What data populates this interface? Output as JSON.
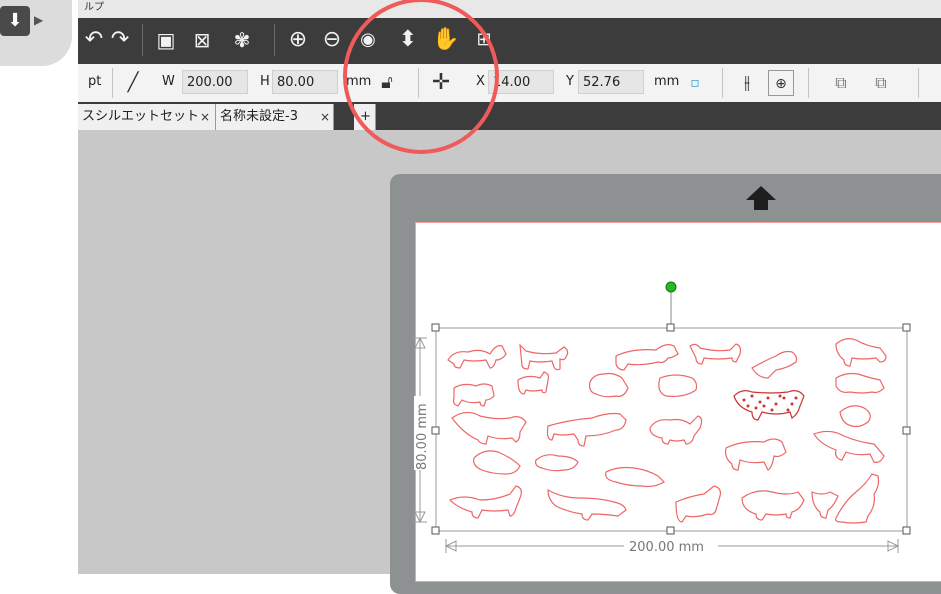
{
  "menu": {
    "partial_label": "ルプ"
  },
  "toolbar": {
    "icons": [
      "undo-icon",
      "redo-icon",
      "select-all-icon",
      "deselect-icon",
      "palette-icon",
      "zoom-in-icon",
      "zoom-out-icon",
      "zoom-selection-icon",
      "move-down-icon",
      "hand-pan-icon",
      "fit-page-icon"
    ]
  },
  "property_bar": {
    "unit_left": "pt",
    "w_label": "W",
    "w_value": "200.00",
    "h_label": "H",
    "h_value": "80.00",
    "size_unit": "mm",
    "x_label": "X",
    "x_value": "14.00",
    "y_label": "Y",
    "y_value": "52.76",
    "pos_unit": "mm"
  },
  "tabs": [
    {
      "label": "スシルエットセット",
      "close": "×"
    },
    {
      "label": "名称未設定-3",
      "close": "×"
    }
  ],
  "add_tab": "+",
  "dimensions": {
    "height_label": "80.00 mm",
    "width_label": "200.00 mm"
  },
  "colors": {
    "toolbar_bg": "#3c3c3c",
    "canvas_bg": "#c8c8c8",
    "mat_bg": "#8e9192",
    "cut_line": "#ee6666",
    "highlight_circle": "#ef5a5a",
    "rotate_handle": "#22bb22"
  }
}
